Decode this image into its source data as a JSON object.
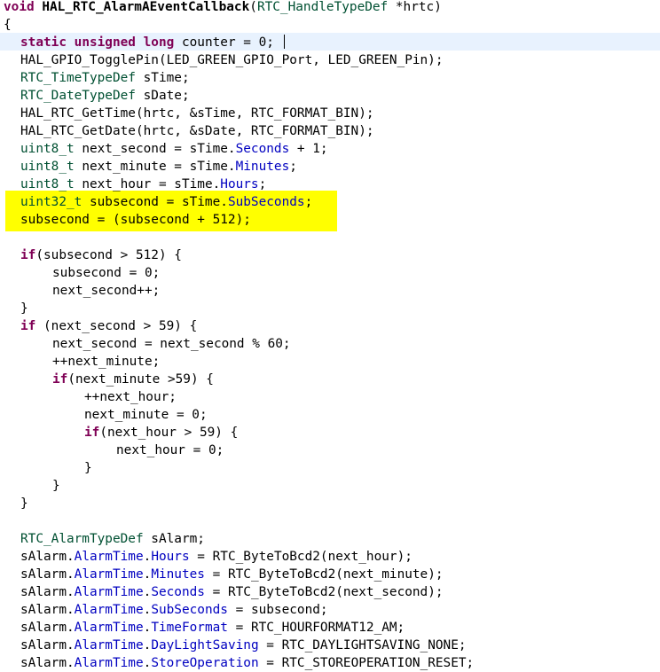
{
  "colors": {
    "keyword": "#7f0055",
    "type": "#005032",
    "field": "#0000c0",
    "plain": "#000000",
    "highlight": "#ffff00",
    "current_line": "#e8f2fe"
  },
  "editor": {
    "lines": [
      {
        "indent": 0,
        "segments": [
          {
            "t": "void",
            "c": "kw"
          },
          {
            "t": " "
          },
          {
            "t": "HAL_RTC_AlarmAEventCallback",
            "c": "bold"
          },
          {
            "t": "("
          },
          {
            "t": "RTC_HandleTypeDef",
            "c": "ty"
          },
          {
            "t": " *hrtc)"
          }
        ]
      },
      {
        "indent": 0,
        "segments": [
          {
            "t": "{"
          }
        ]
      },
      {
        "indent": 1,
        "segments": [
          {
            "t": "static",
            "c": "kw"
          },
          {
            "t": " "
          },
          {
            "t": "unsigned",
            "c": "kw"
          },
          {
            "t": " "
          },
          {
            "t": "long",
            "c": "kw"
          },
          {
            "t": " counter = 0;"
          }
        ]
      },
      {
        "indent": 1,
        "segments": [
          {
            "t": "HAL_GPIO_TogglePin(LED_GREEN_GPIO_Port, LED_GREEN_Pin);"
          }
        ]
      },
      {
        "indent": 1,
        "segments": [
          {
            "t": "RTC_TimeTypeDef",
            "c": "ty"
          },
          {
            "t": " sTime;"
          }
        ]
      },
      {
        "indent": 1,
        "segments": [
          {
            "t": "RTC_DateTypeDef",
            "c": "ty"
          },
          {
            "t": " sDate;"
          }
        ]
      },
      {
        "indent": 1,
        "segments": [
          {
            "t": "HAL_RTC_GetTime(hrtc, &sTime, RTC_FORMAT_BIN);"
          }
        ]
      },
      {
        "indent": 1,
        "segments": [
          {
            "t": "HAL_RTC_GetDate(hrtc, &sDate, RTC_FORMAT_BIN);"
          }
        ]
      },
      {
        "indent": 1,
        "segments": [
          {
            "t": "uint8_t",
            "c": "ty"
          },
          {
            "t": " next_second = sTime."
          },
          {
            "t": "Seconds",
            "c": "fld"
          },
          {
            "t": " + 1;"
          }
        ]
      },
      {
        "indent": 1,
        "segments": [
          {
            "t": "uint8_t",
            "c": "ty"
          },
          {
            "t": " next_minute = sTime."
          },
          {
            "t": "Minutes",
            "c": "fld"
          },
          {
            "t": ";"
          }
        ]
      },
      {
        "indent": 1,
        "segments": [
          {
            "t": "uint8_t",
            "c": "ty"
          },
          {
            "t": " next_hour = sTime."
          },
          {
            "t": "Hours",
            "c": "fld"
          },
          {
            "t": ";"
          }
        ]
      },
      {
        "indent": 1,
        "segments": [
          {
            "t": "uint32_t",
            "c": "ty"
          },
          {
            "t": " subsecond = sTime."
          },
          {
            "t": "SubSeconds",
            "c": "fld"
          },
          {
            "t": ";"
          }
        ]
      },
      {
        "indent": 1,
        "segments": [
          {
            "t": "subsecond = (subsecond + 512);"
          }
        ]
      },
      {
        "indent": 0,
        "segments": []
      },
      {
        "indent": 1,
        "segments": [
          {
            "t": "if",
            "c": "kw"
          },
          {
            "t": "(subsecond > 512) {"
          }
        ]
      },
      {
        "indent": 2,
        "segments": [
          {
            "t": "subsecond = 0;"
          }
        ]
      },
      {
        "indent": 2,
        "segments": [
          {
            "t": "next_second++;"
          }
        ]
      },
      {
        "indent": 1,
        "segments": [
          {
            "t": "}"
          }
        ]
      },
      {
        "indent": 1,
        "segments": [
          {
            "t": "if",
            "c": "kw"
          },
          {
            "t": " (next_second > 59) {"
          }
        ]
      },
      {
        "indent": 2,
        "segments": [
          {
            "t": "next_second = next_second % 60;"
          }
        ]
      },
      {
        "indent": 2,
        "segments": [
          {
            "t": "++next_minute;"
          }
        ]
      },
      {
        "indent": 2,
        "segments": [
          {
            "t": "if",
            "c": "kw"
          },
          {
            "t": "(next_minute >59) {"
          }
        ]
      },
      {
        "indent": 3,
        "segments": [
          {
            "t": "++next_hour;"
          }
        ]
      },
      {
        "indent": 3,
        "segments": [
          {
            "t": "next_minute = 0;"
          }
        ]
      },
      {
        "indent": 3,
        "segments": [
          {
            "t": "if",
            "c": "kw"
          },
          {
            "t": "(next_hour > 59) {"
          }
        ]
      },
      {
        "indent": 4,
        "segments": [
          {
            "t": "next_hour = 0;"
          }
        ]
      },
      {
        "indent": 3,
        "segments": [
          {
            "t": "}"
          }
        ]
      },
      {
        "indent": 2,
        "segments": [
          {
            "t": "}"
          }
        ]
      },
      {
        "indent": 1,
        "segments": [
          {
            "t": "}"
          }
        ]
      },
      {
        "indent": 0,
        "segments": []
      },
      {
        "indent": 1,
        "segments": [
          {
            "t": "RTC_AlarmTypeDef",
            "c": "ty"
          },
          {
            "t": " sAlarm;"
          }
        ]
      },
      {
        "indent": 1,
        "segments": [
          {
            "t": "sAlarm."
          },
          {
            "t": "AlarmTime",
            "c": "fld"
          },
          {
            "t": "."
          },
          {
            "t": "Hours",
            "c": "fld"
          },
          {
            "t": " = RTC_ByteToBcd2(next_hour);"
          }
        ]
      },
      {
        "indent": 1,
        "segments": [
          {
            "t": "sAlarm."
          },
          {
            "t": "AlarmTime",
            "c": "fld"
          },
          {
            "t": "."
          },
          {
            "t": "Minutes",
            "c": "fld"
          },
          {
            "t": " = RTC_ByteToBcd2(next_minute);"
          }
        ]
      },
      {
        "indent": 1,
        "segments": [
          {
            "t": "sAlarm."
          },
          {
            "t": "AlarmTime",
            "c": "fld"
          },
          {
            "t": "."
          },
          {
            "t": "Seconds",
            "c": "fld"
          },
          {
            "t": " = RTC_ByteToBcd2(next_second);"
          }
        ]
      },
      {
        "indent": 1,
        "segments": [
          {
            "t": "sAlarm."
          },
          {
            "t": "AlarmTime",
            "c": "fld"
          },
          {
            "t": "."
          },
          {
            "t": "SubSeconds",
            "c": "fld"
          },
          {
            "t": " = subsecond;"
          }
        ]
      },
      {
        "indent": 1,
        "segments": [
          {
            "t": "sAlarm."
          },
          {
            "t": "AlarmTime",
            "c": "fld"
          },
          {
            "t": "."
          },
          {
            "t": "TimeFormat",
            "c": "fld"
          },
          {
            "t": " = RTC_HOURFORMAT12_AM;"
          }
        ]
      },
      {
        "indent": 1,
        "segments": [
          {
            "t": "sAlarm."
          },
          {
            "t": "AlarmTime",
            "c": "fld"
          },
          {
            "t": "."
          },
          {
            "t": "DayLightSaving",
            "c": "fld"
          },
          {
            "t": " = RTC_DAYLIGHTSAVING_NONE;"
          }
        ]
      },
      {
        "indent": 1,
        "segments": [
          {
            "t": "sAlarm."
          },
          {
            "t": "AlarmTime",
            "c": "fld"
          },
          {
            "t": "."
          },
          {
            "t": "StoreOperation",
            "c": "fld"
          },
          {
            "t": " = RTC_STOREOPERATION_RESET;"
          }
        ]
      }
    ]
  }
}
